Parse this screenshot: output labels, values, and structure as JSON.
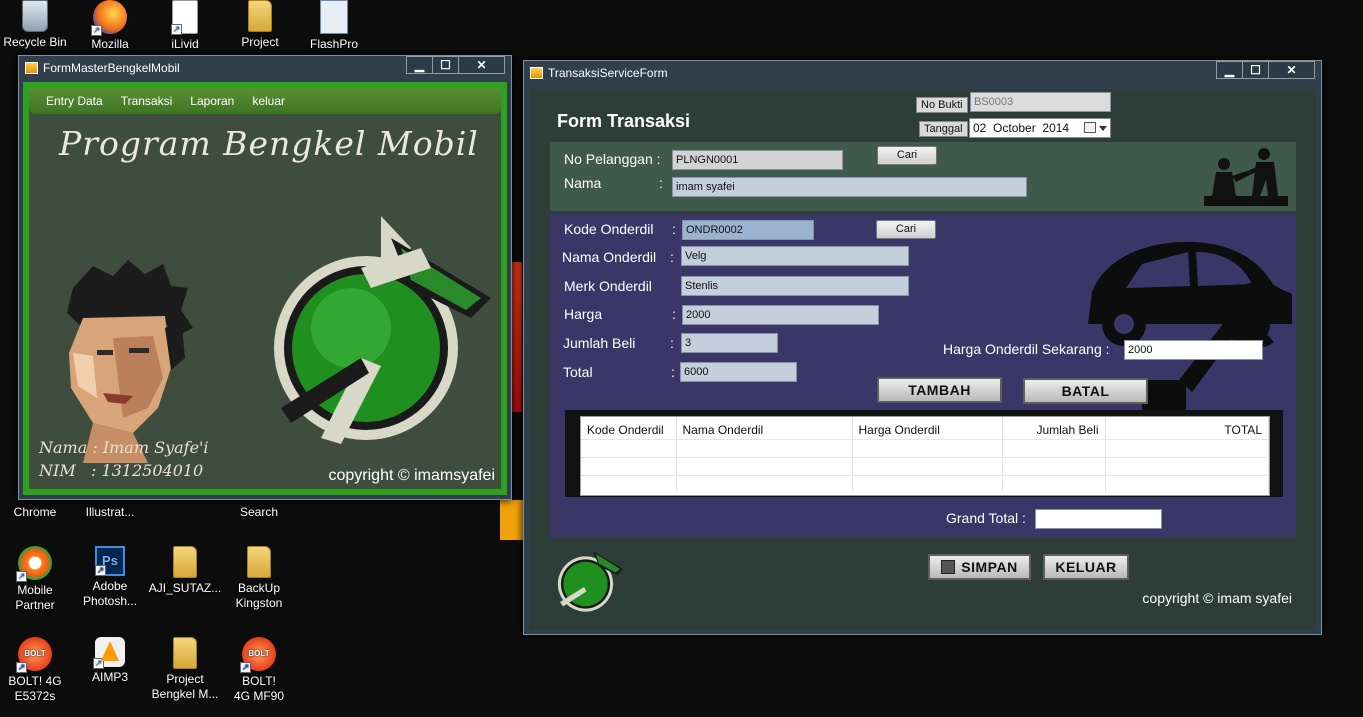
{
  "desktop": {
    "icons": [
      {
        "label": "Recycle Bin",
        "icon": "recycle-bin-icon"
      },
      {
        "label": "Mozilla",
        "icon": "firefox-icon"
      },
      {
        "label": "iLivid",
        "icon": "ilivid-icon"
      },
      {
        "label": "Project",
        "icon": "folder-icon"
      },
      {
        "label": "FlashPro",
        "icon": "flashpro-icon"
      },
      {
        "label": "Chrome",
        "icon": "chrome-icon"
      },
      {
        "label": "Illustrat...",
        "icon": "illustrator-icon"
      },
      {
        "label": "Search",
        "icon": "search-icon"
      },
      {
        "label": "Mobile Partner",
        "icon": "mobile-partner-icon"
      },
      {
        "label": "Adobe Photosh...",
        "icon": "photoshop-icon"
      },
      {
        "label": "AJI_SUTAZ...",
        "icon": "folder-icon"
      },
      {
        "label": "BackUp Kingston",
        "icon": "folder-icon"
      },
      {
        "label": "BOLT! 4G E5372s",
        "icon": "bolt-icon"
      },
      {
        "label": "AIMP3",
        "icon": "aimp-icon"
      },
      {
        "label": "Project Bengkel M...",
        "icon": "folder-icon"
      },
      {
        "label": "BOLT! 4G MF90",
        "icon": "bolt-icon"
      }
    ]
  },
  "master_window": {
    "title": "FormMasterBengkelMobil",
    "menu": [
      "Entry Data",
      "Transaksi",
      "Laporan",
      "keluar"
    ],
    "banner_title": "Program Bengkel Mobil",
    "nama_line": "Nama : Imam Syafe'i",
    "nim_line": "NIM   : 1312504010",
    "copyright": "copyright © imamsyafei"
  },
  "trans_window": {
    "title": "TransaksiServiceForm",
    "form_title": "Form Transaksi",
    "no_bukti_label": "No Bukti",
    "no_bukti_value": "BS0003",
    "tanggal_label": "Tanggal",
    "tanggal_day": "02",
    "tanggal_month": "October",
    "tanggal_year": "2014",
    "pelanggan": {
      "no_label": "No Pelanggan :",
      "no_value": "PLNGN0001",
      "cari_label": "Cari",
      "nama_label": "Nama",
      "nama_value": "imam syafei"
    },
    "onderdil": {
      "kode_label": "Kode Onderdil",
      "kode_value": "ONDR0002",
      "cari_label": "Cari",
      "nama_label": "Nama Onderdil",
      "nama_value": "Velg",
      "merk_label": "Merk Onderdil",
      "merk_value": "Stenlis",
      "harga_label": "Harga",
      "harga_value": "2000",
      "jumlah_label": "Jumlah Beli",
      "jumlah_value": "3",
      "total_label": "Total",
      "total_value": "6000",
      "harga_sekarang_label": "Harga Onderdil Sekarang :",
      "harga_sekarang_value": "2000",
      "tambah_label": "TAMBAH",
      "batal_label": "BATAL"
    },
    "grid": {
      "columns": [
        "Kode Onderdil",
        "Nama Onderdil",
        "Harga Onderdil",
        "Jumlah Beli",
        "TOTAL"
      ]
    },
    "grand_total_label": "Grand Total :",
    "grand_total_value": "",
    "simpan_label": "SIMPAN",
    "keluar_label": "KELUAR",
    "copyright": "copyright © imam syafei"
  },
  "colors": {
    "menu_green": "#3e7524",
    "border_green": "#2ea21c",
    "panel_purple": "#3a3768",
    "panel_green": "#3f5a4c"
  }
}
